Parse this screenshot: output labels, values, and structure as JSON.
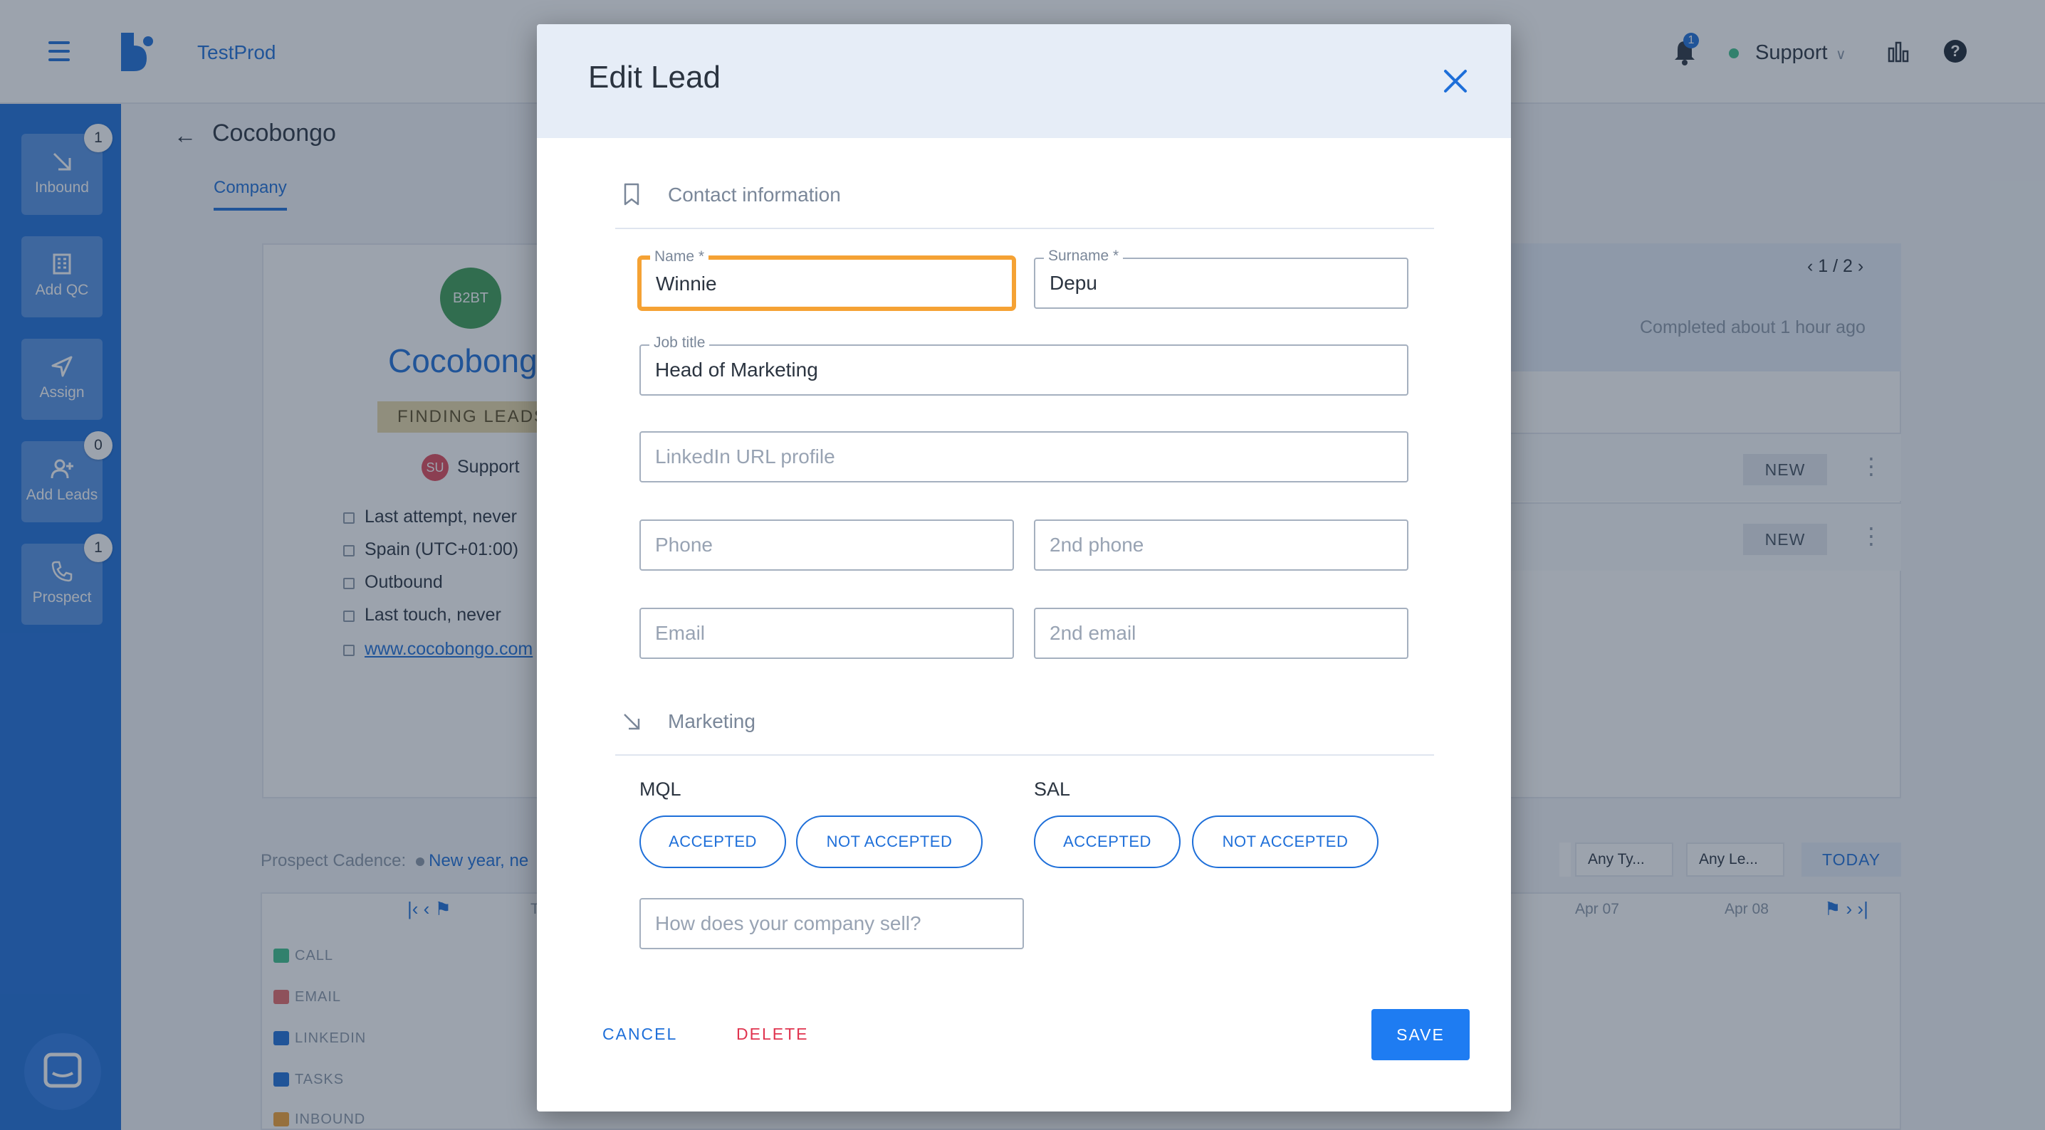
{
  "app": {
    "name": "TestProd"
  },
  "header": {
    "notifications_count": "1",
    "user_name": "Support"
  },
  "sidebar": {
    "items": [
      {
        "label": "Inbound",
        "badge": "1"
      },
      {
        "label": "Add QC",
        "badge": ""
      },
      {
        "label": "Assign",
        "badge": ""
      },
      {
        "label": "Add Leads",
        "badge": "0"
      },
      {
        "label": "Prospect",
        "badge": "1"
      }
    ]
  },
  "company": {
    "title": "Cocobongo",
    "tab": "Company",
    "avatar_initials": "B2BT",
    "name": "Cocobong",
    "status": "FINDING LEADS",
    "owner_initials": "SU",
    "owner": "Support",
    "info": [
      "Last attempt, never",
      "Spain (UTC+01:00)",
      "Outbound",
      "Last touch, never"
    ],
    "website": "www.cocobongo.com"
  },
  "right_panel": {
    "pager": "1 / 2",
    "completed": "Completed about 1 hour ago",
    "rows": [
      {
        "badge": "NEW"
      },
      {
        "badge": "NEW"
      }
    ]
  },
  "cadence": {
    "label": "Prospect Cadence:",
    "link": "New year, ne",
    "filters": [
      "Any Ty...",
      "Any Le..."
    ],
    "today": "TODAY",
    "channels": [
      "CALL",
      "EMAIL",
      "LINKEDIN",
      "TASKS",
      "INBOUND"
    ],
    "dates": [
      "Apr 07",
      "Apr 08"
    ],
    "partial": "T"
  },
  "modal": {
    "title": "Edit Lead",
    "contact_section": "Contact information",
    "fields": {
      "name": {
        "label": "Name *",
        "value": "Winnie"
      },
      "surname": {
        "label": "Surname *",
        "value": "Depu"
      },
      "job_title": {
        "label": "Job title",
        "value": "Head of Marketing"
      },
      "linkedin": {
        "placeholder": "LinkedIn URL profile"
      },
      "phone": {
        "placeholder": "Phone"
      },
      "phone2": {
        "placeholder": "2nd phone"
      },
      "email": {
        "placeholder": "Email"
      },
      "email2": {
        "placeholder": "2nd email"
      }
    },
    "marketing_section": "Marketing",
    "mql": {
      "label": "MQL",
      "accepted": "ACCEPTED",
      "not_accepted": "NOT ACCEPTED"
    },
    "sal": {
      "label": "SAL",
      "accepted": "ACCEPTED",
      "not_accepted": "NOT ACCEPTED"
    },
    "sell_placeholder": "How does your company sell?",
    "cancel": "CANCEL",
    "delete": "DELETE",
    "save": "SAVE"
  },
  "colors": {
    "brand": "#1e6fd9",
    "focus": "#f5a234",
    "danger": "#e0344f"
  }
}
